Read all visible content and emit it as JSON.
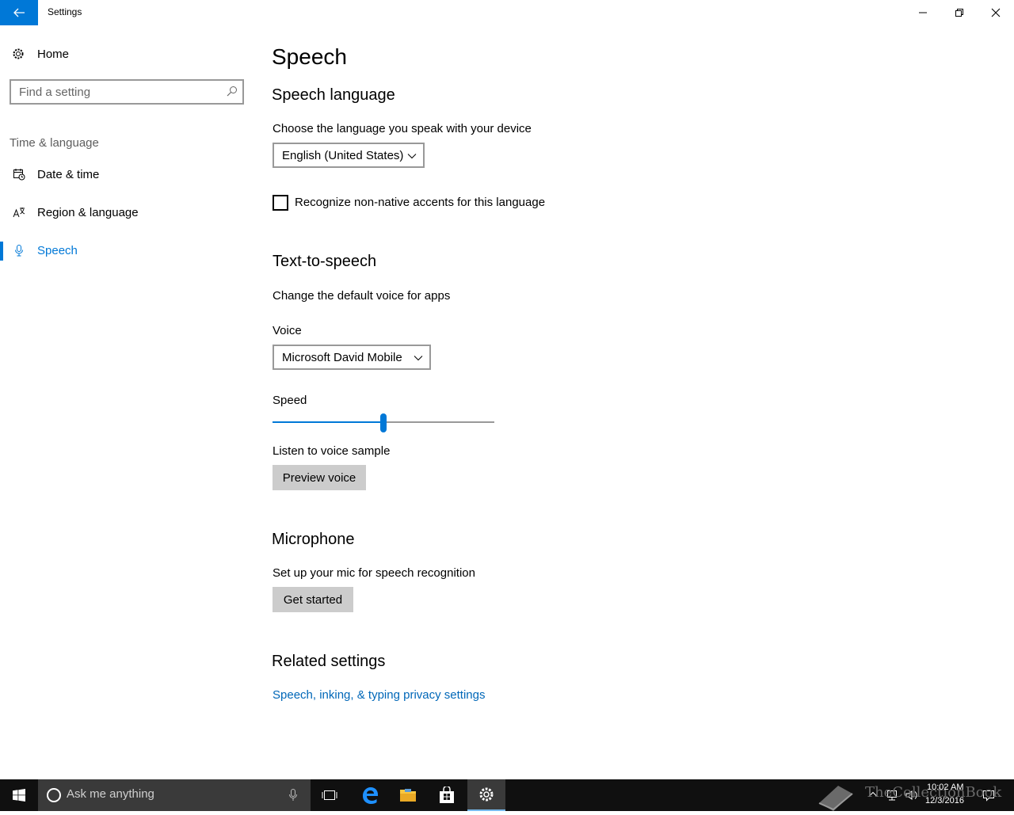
{
  "window": {
    "title": "Settings"
  },
  "sidebar": {
    "home_label": "Home",
    "search_placeholder": "Find a setting",
    "section_label": "Time & language",
    "items": [
      {
        "label": "Date & time",
        "icon": "calendar-clock-icon"
      },
      {
        "label": "Region & language",
        "icon": "language-icon"
      },
      {
        "label": "Speech",
        "icon": "microphone-icon",
        "active": true
      }
    ]
  },
  "main": {
    "page_title": "Speech",
    "speech_language": {
      "heading": "Speech language",
      "description": "Choose the language you speak with your device",
      "selected_language": "English (United States)",
      "checkbox_label": "Recognize non-native accents for this language",
      "checkbox_checked": false
    },
    "tts": {
      "heading": "Text-to-speech",
      "description": "Change the default voice for apps",
      "voice_label": "Voice",
      "selected_voice": "Microsoft David Mobile",
      "speed_label": "Speed",
      "speed_value": 0.5,
      "sample_label": "Listen to voice sample",
      "preview_button": "Preview voice"
    },
    "microphone": {
      "heading": "Microphone",
      "description": "Set up your mic for speech recognition",
      "button": "Get started"
    },
    "related": {
      "heading": "Related settings",
      "link": "Speech, inking, & typing privacy settings"
    }
  },
  "taskbar": {
    "search_placeholder": "Ask me anything",
    "time": "10:02 AM",
    "date": "12/3/2016",
    "watermark": "TheCollectionBook"
  },
  "colors": {
    "accent": "#0078d7",
    "link": "#0067b8",
    "taskbar": "#101010"
  }
}
